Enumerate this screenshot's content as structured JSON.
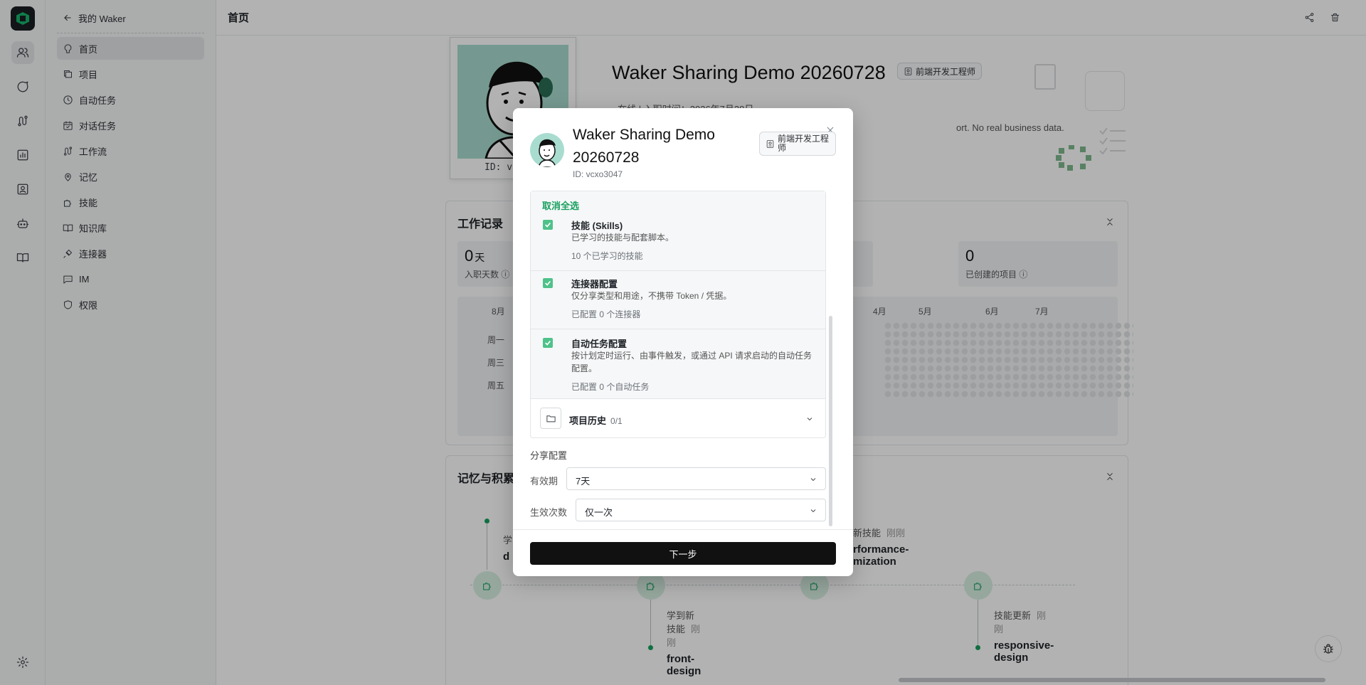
{
  "sidebar": {
    "back_label": "我的 Waker",
    "items": [
      {
        "label": "首页",
        "icon": "home-icon"
      },
      {
        "label": "项目",
        "icon": "folders-icon"
      },
      {
        "label": "自动任务",
        "icon": "clock-icon"
      },
      {
        "label": "对话任务",
        "icon": "calendar-check-icon"
      },
      {
        "label": "工作流",
        "icon": "workflow-icon"
      },
      {
        "label": "记忆",
        "icon": "brain-icon"
      },
      {
        "label": "技能",
        "icon": "puzzle-icon"
      },
      {
        "label": "知识库",
        "icon": "book-icon"
      },
      {
        "label": "连接器",
        "icon": "plug-icon"
      },
      {
        "label": "IM",
        "icon": "chat-icon"
      },
      {
        "label": "权限",
        "icon": "shield-icon"
      }
    ]
  },
  "header": {
    "title": "首页"
  },
  "profile": {
    "name": "Waker Sharing Demo 20260728",
    "role": "前端开发工程师",
    "id_partial": "ID: v",
    "meta_partial": "• 在线  |  入职时间：2026年7月28日",
    "desc_partial": "ort. No real business data."
  },
  "work_record": {
    "title": "工作记录",
    "stats": [
      {
        "value": "0",
        "unit": "天",
        "label": "入职天数 ⓘ"
      },
      {
        "value": "0",
        "unit": "",
        "label": "已创建的项目 ⓘ"
      }
    ],
    "months": [
      "8月",
      "4月",
      "5月",
      "6月",
      "7月"
    ],
    "days": [
      "周一",
      "周三",
      "周五"
    ]
  },
  "memory": {
    "title": "记忆与积累",
    "events": [
      {
        "type": "学",
        "time": "",
        "name": "d"
      },
      {
        "type": "学到新技能",
        "time": "刚刚",
        "name": "front-design"
      },
      {
        "type": "新技能",
        "time": "刚刚",
        "name": "rformance-"
      },
      {
        "type": "技能更新",
        "time": "刚刚",
        "name": "responsive-design"
      }
    ],
    "fragments": [
      "mization"
    ]
  },
  "modal": {
    "name": "Waker Sharing Demo 20260728",
    "id": "ID: vcxo3047",
    "role": "前端开发工程师",
    "deselect_all": "取消全选",
    "options": [
      {
        "title": "技能 (Skills)",
        "desc": "已学习的技能与配套脚本。",
        "count": "10 个已学习的技能",
        "checked": true
      },
      {
        "title": "连接器配置",
        "desc": "仅分享类型和用途，不携带 Token / 凭据。",
        "count": "已配置 0 个连接器",
        "checked": true
      },
      {
        "title": "自动任务配置",
        "desc": "按计划定时运行、由事件触发，或通过 API 请求启动的自动任务配置。",
        "count": "已配置 0 个自动任务",
        "checked": true
      }
    ],
    "project_history": {
      "label": "项目历史",
      "count": "0/1"
    },
    "share_title": "分享配置",
    "validity": {
      "label": "有效期",
      "value": "7天"
    },
    "uses": {
      "label": "生效次数",
      "value": "仅一次"
    },
    "next_label": "下一步"
  },
  "colors": {
    "accent_green": "#16a05d",
    "checkbox_green": "#4ec28a",
    "primary_button": "#111111"
  }
}
